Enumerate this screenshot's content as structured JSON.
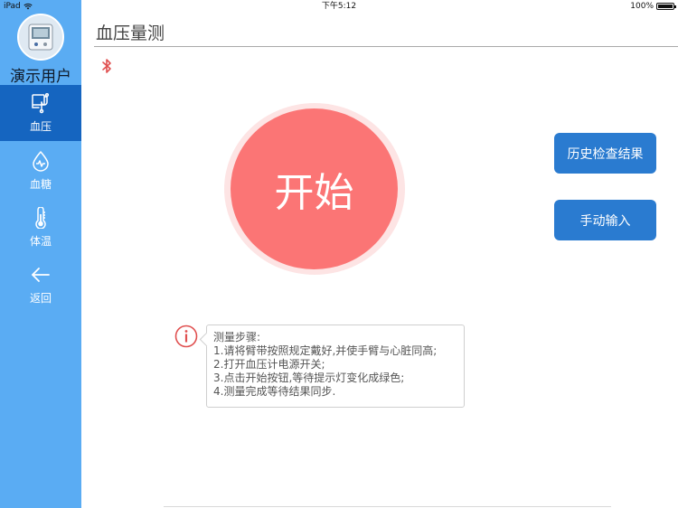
{
  "status_bar": {
    "device": "iPad",
    "time": "下午5:12",
    "battery": "100%"
  },
  "sidebar": {
    "username": "演示用户",
    "items": [
      {
        "label": "血压",
        "icon": "stethoscope-icon",
        "active": true
      },
      {
        "label": "血糖",
        "icon": "blood-drop-icon",
        "active": false
      },
      {
        "label": "体温",
        "icon": "thermometer-icon",
        "active": false
      },
      {
        "label": "返回",
        "icon": "back-arrow-icon",
        "active": false
      }
    ]
  },
  "header": {
    "title": "血压量测"
  },
  "main": {
    "start_label": "开始",
    "history_label": "历史检查结果",
    "manual_label": "手动输入",
    "steps": [
      "测量步骤:",
      "1.请将臂带按照规定戴好,并使手臂与心脏同高;",
      "2.打开血压计电源开关;",
      "3.点击开始按钮,等待提示灯变化成绿色;",
      "4.测量完成等待结果同步."
    ]
  },
  "colors": {
    "sidebar": "#5aacf3",
    "sidebar_active": "#1565c0",
    "start_button": "#fb7575",
    "action_button": "#2a7bd0",
    "bluetooth": "#e05050"
  }
}
